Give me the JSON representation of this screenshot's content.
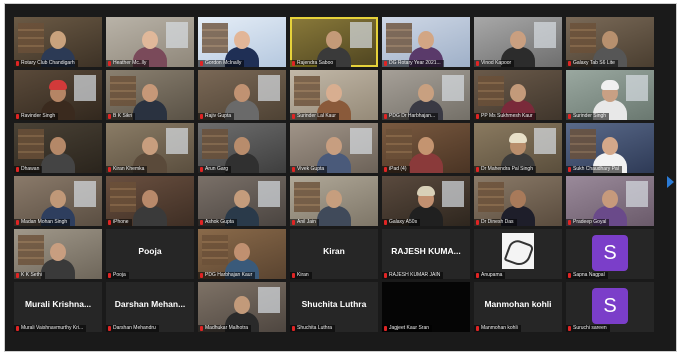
{
  "gallery": {
    "tiles": [
      {
        "name": "Rotary Club Chandigarh",
        "type": "video",
        "bg1": "#6b5a45",
        "bg2": "#3d3226",
        "skin": "#c9a27d",
        "shirt": "#2c3a55"
      },
      {
        "name": "Heather Mc..lly",
        "type": "video",
        "bg1": "#b9b3a8",
        "bg2": "#8f877a",
        "skin": "#e0b89a",
        "shirt": "#7a4a5a"
      },
      {
        "name": "Gordon McInally",
        "type": "video",
        "bg1": "#e6eef7",
        "bg2": "#b5c8df",
        "skin": "#e2b698",
        "shirt": "#1f2f55"
      },
      {
        "name": "Rajendra Saboo",
        "type": "video",
        "bg1": "#8a7a3a",
        "bg2": "#4e4420",
        "skin": "#c49a78",
        "shirt": "#3a3a3a",
        "active": true
      },
      {
        "name": "DG Rotary Year 2021...",
        "type": "video",
        "bg1": "#cfd8e6",
        "bg2": "#9fb0c8",
        "skin": "#d2a684",
        "shirt": "#5a3a6a"
      },
      {
        "name": "Vinod Kapoor",
        "type": "video",
        "bg1": "#a8a8a8",
        "bg2": "#6e6e6e",
        "skin": "#c99f80",
        "shirt": "#2c2c2c"
      },
      {
        "name": "Galaxy Tab S6 Lite",
        "type": "video",
        "bg1": "#7a6a58",
        "bg2": "#4a3e30",
        "skin": "#b7906e",
        "shirt": "#565656"
      },
      {
        "name": "Ravinder Singh",
        "type": "video",
        "bg1": "#5a4a3a",
        "bg2": "#32281e",
        "skin": "#b58565",
        "shirt": "#3a2a1e",
        "turban": "#d23a3a"
      },
      {
        "name": "B K Sikri",
        "type": "video",
        "bg1": "#8a8070",
        "bg2": "#5a5246",
        "skin": "#c69878",
        "shirt": "#2a3240"
      },
      {
        "name": "Rajiv Gupta",
        "type": "video",
        "bg1": "#7a6856",
        "bg2": "#4e4234",
        "skin": "#c09272",
        "shirt": "#6a6a6a"
      },
      {
        "name": "Surinder Lal Kaur",
        "type": "video",
        "bg1": "#c2b8a8",
        "bg2": "#958a78",
        "skin": "#d8ae90",
        "shirt": "#8a5a3a"
      },
      {
        "name": "PDG Dr Harbhajan...",
        "type": "video",
        "bg1": "#a6a098",
        "bg2": "#747068",
        "skin": "#c8a080",
        "shirt": "#3a3a44"
      },
      {
        "name": "PP Ms Sukhmesh Kaur",
        "type": "video",
        "bg1": "#6a5a4a",
        "bg2": "#40362c",
        "skin": "#c39a7a",
        "shirt": "#7a2a3a"
      },
      {
        "name": "Surinder Singh",
        "type": "video",
        "bg1": "#9aa8a0",
        "bg2": "#6a7870",
        "skin": "#c8a084",
        "shirt": "#e8e8e8",
        "turban": "#f0f0f0"
      },
      {
        "name": "Dhawan",
        "type": "video",
        "bg1": "#4a4236",
        "bg2": "#2a241c",
        "skin": "#b48868",
        "shirt": "#444444"
      },
      {
        "name": "Kiran Khemka",
        "type": "video",
        "bg1": "#8a7c66",
        "bg2": "#5a4e3e",
        "skin": "#c89e7e",
        "shirt": "#5a4a3a"
      },
      {
        "name": "Arun Garg",
        "type": "video",
        "bg1": "#6e6e6e",
        "bg2": "#3e3e3e",
        "skin": "#b88c6c",
        "shirt": "#303030"
      },
      {
        "name": "Vivek Gupta",
        "type": "video",
        "bg1": "#a09488",
        "bg2": "#6c6258",
        "skin": "#c79e80",
        "shirt": "#4a5a7a"
      },
      {
        "name": "iPad (4)",
        "type": "video",
        "bg1": "#7a5a40",
        "bg2": "#4a3424",
        "skin": "#c49470",
        "shirt": "#8a3a3a"
      },
      {
        "name": "Dr Mahendra Pal Singh",
        "type": "video",
        "bg1": "#8a7a60",
        "bg2": "#5a4e3c",
        "skin": "#b98e6c",
        "shirt": "#3a3a3a",
        "turban": "#e8e0c8"
      },
      {
        "name": "Sukh Chaudhary Pal",
        "type": "video",
        "bg1": "#5a6a8a",
        "bg2": "#2e3a56",
        "skin": "#d4a88a",
        "shirt": "#f2f2f2"
      },
      {
        "name": "Madan Mohan Singh",
        "type": "video",
        "bg1": "#8a7a6a",
        "bg2": "#5a4e42",
        "skin": "#c09878",
        "shirt": "#2e3e5e"
      },
      {
        "name": "iPhone",
        "type": "video",
        "bg1": "#6a5040",
        "bg2": "#3e2e24",
        "skin": "#b8896a",
        "shirt": "#3a3a3a"
      },
      {
        "name": "Ashok Gupta",
        "type": "video",
        "bg1": "#7a7068",
        "bg2": "#4a4440",
        "skin": "#c49c7c",
        "shirt": "#2a3a4a"
      },
      {
        "name": "Anil Jain",
        "type": "video",
        "bg1": "#b0a898",
        "bg2": "#7e7668",
        "skin": "#c69e7e",
        "shirt": "#404a5a"
      },
      {
        "name": "Galaxy A50s",
        "type": "video",
        "bg1": "#5a4a3e",
        "bg2": "#2e261e",
        "skin": "#c29070",
        "shirt": "#202020",
        "turban": "#d8d0b8"
      },
      {
        "name": "Dr Dinesh Das",
        "type": "video",
        "bg1": "#8a7a68",
        "bg2": "#5a4c3e",
        "skin": "#a87a5a",
        "shirt": "#1e1e2a"
      },
      {
        "name": "Pradeep Goyal",
        "type": "video",
        "bg1": "#9a8a9a",
        "bg2": "#6a5a6a",
        "skin": "#c69a7c",
        "shirt": "#6a4a8a"
      },
      {
        "name": "K K Sethi",
        "type": "video",
        "bg1": "#a0988a",
        "bg2": "#6e665a",
        "skin": "#c89e80",
        "shirt": "#3a3a3a"
      },
      {
        "name": "Pooja",
        "type": "text",
        "big": "Pooja"
      },
      {
        "name": "PDG Harbhajan Kaur",
        "type": "video",
        "bg1": "#8a6a4a",
        "bg2": "#5a4430",
        "skin": "#c09070",
        "shirt": "#3a5a7a"
      },
      {
        "name": "Kiran",
        "type": "text",
        "big": "Kiran"
      },
      {
        "name": "RAJESH KUMAR JAIN",
        "type": "text",
        "big": "RAJESH KUMA..."
      },
      {
        "name": "Anupama",
        "type": "sketch"
      },
      {
        "name": "Sapna Nagpal",
        "type": "avatar",
        "letter": "S",
        "color": "#7b3ec9"
      },
      {
        "name": "Murali Vaishnavmurthy Kri...",
        "type": "text",
        "big": "Murali Krishna..."
      },
      {
        "name": "Darshan Mehandru",
        "type": "text",
        "big": "Darshan Mehan..."
      },
      {
        "name": "Madhukar Malhotra",
        "type": "video",
        "bg1": "#7e7266",
        "bg2": "#4e4640",
        "skin": "#c29a7a",
        "shirt": "#2a2a2a"
      },
      {
        "name": "Shuchita Luthra",
        "type": "text",
        "big": "Shuchita Luthra"
      },
      {
        "name": "Jagjeet Kaur Sran",
        "type": "blank"
      },
      {
        "name": "Manmohan kohli",
        "type": "text",
        "big": "Manmohan kohli"
      },
      {
        "name": "Suruchi sareen",
        "type": "avatar",
        "letter": "S",
        "color": "#7b3ec9"
      }
    ]
  }
}
